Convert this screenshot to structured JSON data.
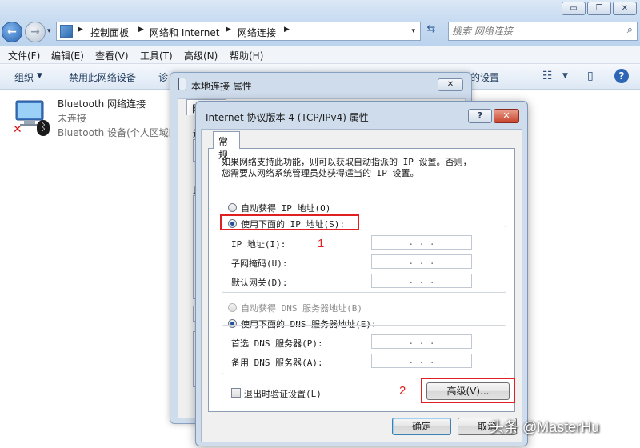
{
  "window": {
    "btn_min": "▭",
    "btn_max": "❐",
    "btn_close": "✕"
  },
  "nav": {
    "back_icon": "←",
    "forward_icon": "→",
    "dropdown_icon": "▾"
  },
  "address": {
    "crumbs": [
      "控制面板",
      "网络和 Internet",
      "网络连接"
    ],
    "separator": "▶",
    "dropdown_icon": "▾",
    "refresh_icon": "⇆"
  },
  "search": {
    "placeholder": "搜索 网络连接",
    "icon": "⌕"
  },
  "menu": [
    "文件(F)",
    "编辑(E)",
    "查看(V)",
    "工具(T)",
    "高级(N)",
    "帮助(H)"
  ],
  "toolbar": {
    "organize": "组织",
    "organize_arrow": "▼",
    "disable_device": "禁用此网络设备",
    "diagnose_fragment": "诊",
    "settings_fragment": "的设置",
    "view_icon": "☷",
    "view_arrow": "▼",
    "pane_icon": "▯",
    "help_icon": "?"
  },
  "connection": {
    "name": "Bluetooth 网络连接",
    "status": "未连接",
    "device": "Bluetooth 设备(个人区域网",
    "x_mark": "✕",
    "bt_mark": "ᛒ"
  },
  "bg_dialog": {
    "title": "本地连接 属性",
    "close": "✕",
    "tab": "网",
    "frag1": "连",
    "frag2": "此"
  },
  "ipv4_dialog": {
    "title": "Internet 协议版本 4 (TCP/IPv4) 属性",
    "help_btn": "?",
    "close_btn": "✕",
    "tab_general": "常规",
    "description_line1": "如果网络支持此功能，则可以获取自动指派的 IP 设置。否则，",
    "description_line2": "您需要从网络系统管理员处获得适当的 IP 设置。",
    "radio_auto_ip": "自动获得 IP 地址(O)",
    "radio_manual_ip": "使用下面的 IP 地址(S):",
    "ip_label": "IP 地址(I):",
    "subnet_label": "子网掩码(U):",
    "gateway_label": "默认网关(D):",
    "ip_value": ".   .   .",
    "subnet_value": ".   .   .",
    "gateway_value": ".   .   .",
    "radio_auto_dns": "自动获得 DNS 服务器地址(B)",
    "radio_manual_dns": "使用下面的 DNS 服务器地址(E):",
    "preferred_dns_label": "首选 DNS 服务器(P):",
    "alternate_dns_label": "备用 DNS 服务器(A):",
    "preferred_dns_value": ".   .   .",
    "alternate_dns_value": ".   .   .",
    "validate_checkbox": "退出时验证设置(L)",
    "advanced_btn": "高级(V)...",
    "ok_btn": "确定",
    "cancel_btn": "取消"
  },
  "annotations": {
    "label1": "1",
    "label2": "2"
  },
  "watermark": "头条 @MasterHu"
}
